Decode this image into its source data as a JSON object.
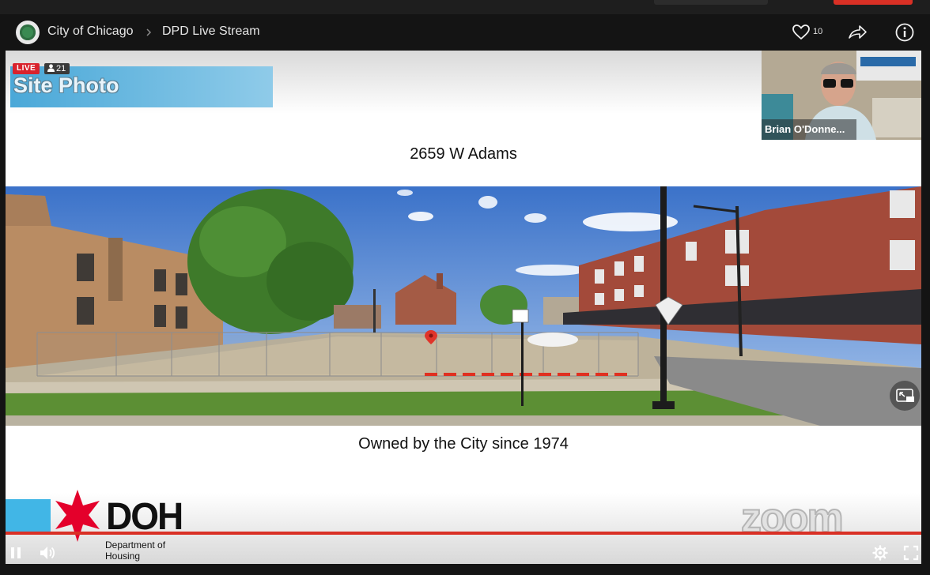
{
  "header": {
    "breadcrumb_org": "City of Chicago",
    "breadcrumb_stream": "DPD Live Stream",
    "like_count": "10"
  },
  "overlay": {
    "live_label": "LIVE",
    "viewer_count": "21"
  },
  "slide": {
    "banner_title": "Site Photo",
    "address": "2659 W Adams",
    "caption": "Owned by the City since 1974",
    "doh_mark": "DOH",
    "doh_sub_line1": "Department of",
    "doh_sub_line2": "Housing",
    "watermark": "zoom"
  },
  "camera": {
    "participant_name": "Brian O'Donne..."
  },
  "colors": {
    "accent_red": "#d93025",
    "doh_blue": "#41b6e6",
    "star_red": "#e4002b"
  },
  "icons": [
    "chicago-seal-icon",
    "chevron-right-icon",
    "heart-icon",
    "share-icon",
    "info-icon",
    "person-icon",
    "pip-icon",
    "pause-icon",
    "volume-icon",
    "settings-icon",
    "fullscreen-icon"
  ]
}
